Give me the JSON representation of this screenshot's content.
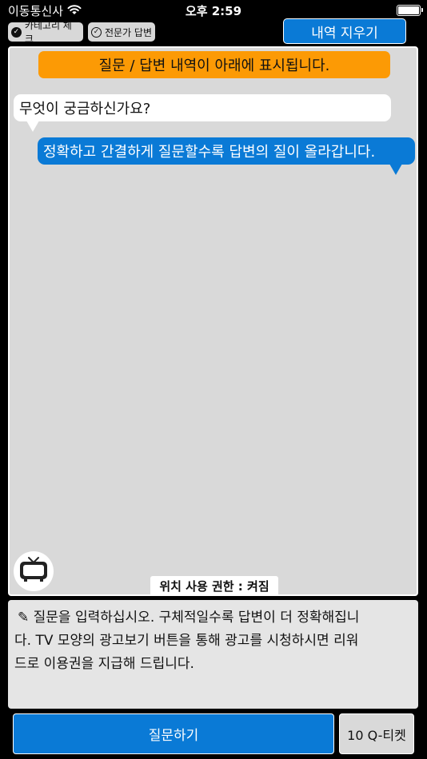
{
  "status_bar": {
    "carrier": "이동통신사",
    "time": "오후 2:59"
  },
  "options": {
    "category_check_label": "카테고리 체크",
    "expert_answer_label": "전문가 답변"
  },
  "toolbar": {
    "clear_history_label": "내역 지우기"
  },
  "chat": {
    "banner": "질문 / 답변 내역이 아래에 표시됩니다.",
    "messages": [
      {
        "side": "left",
        "text": "무엇이 궁금하신가요?"
      },
      {
        "side": "right",
        "text": "정확하고 간결하게 질문할수록 답변의 질이 올라갑니다."
      }
    ],
    "location_permission": "위치 사용 권한 : 켜짐",
    "ad_button_icon": "tv-icon"
  },
  "question_input": {
    "placeholder_lines": [
      "질문을 입력하십시오. 구체적일수록 답변이 더 정확해집니",
      "다. TV 모양의 광고보기 버튼을 통해 광고를 시청하시면 리워",
      "드로 이용권을 지급해 드립니다."
    ]
  },
  "actions": {
    "ask_label": "질문하기",
    "ticket_label": "10 Q-티켓"
  },
  "colors": {
    "accent_blue": "#0a7ad6",
    "banner_orange": "#fc9a05",
    "chat_bg": "#d9d9d9"
  }
}
